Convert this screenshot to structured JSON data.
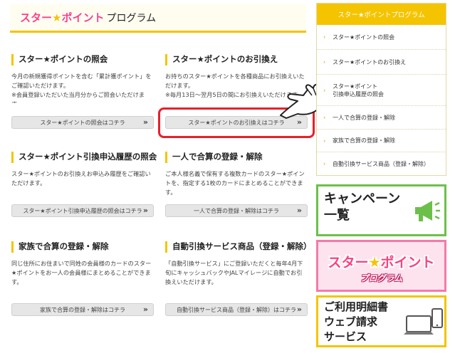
{
  "header": {
    "logo_text_1": "スター",
    "logo_star": "★",
    "logo_text_2": "ポイント",
    "subtitle": "プログラム"
  },
  "sections": [
    {
      "title": "スター★ポイントの照会",
      "desc": "今月の新規獲得ポイントを含む「累計獲ポイント」をご確認いただけます。\n※会員登録いただいた当月分からご照会いただけます。",
      "button": "スター★ポイントの照会はコチラ"
    },
    {
      "title": "スター★ポイントのお引換え",
      "desc": "お持ちのスター★ポイントを各種商品にお引換えいただけます。\n※毎月13日～翌月5日の間にお引換えいただけます。",
      "button": "スター★ポイントのお引換えはコチラ"
    },
    {
      "title": "スター★ポイント引換申込履歴の照会",
      "desc": "スター★ポイントのお引換えお申込み履歴をご確認いただけます。",
      "button": "スター★ポイント引換申込履歴の照会はコチラ"
    },
    {
      "title": "一人で合算の登録・解除",
      "desc": "ご本人様名義で保有する複数カードのスター★ポイントを、指定する1枚のカードにまとめることができます。",
      "button": "一人で合算の登録・解除はコチラ"
    },
    {
      "title": "家族で合算の登録・解除",
      "desc": "同じ住所にお住まいで同姓の会員様のカードのスター★ポイントをお一人の会員様にまとめることができます。",
      "button": "家族で合算の登録・解除はコチラ"
    },
    {
      "title": "自動引換サービス商品（登録・解除）",
      "desc": "「自動引換サービス」にご登録いただくと毎年4月下旬にキャッシュバックやJALマイレージに自動でお引換えいただけます。",
      "button": "自動引換サービス商品（登録・解除）はコチラ"
    }
  ],
  "chevron": "»",
  "sidebar": {
    "title": "スター★ポイントプログラム",
    "items": [
      "スター★ポイントの照会",
      "スター★ポイントのお引換え",
      "スター★ポイント\n引換申込履歴の照会",
      "一人で合算の登録・解除",
      "家族で合算の登録・解除",
      "自動引換サービス商品（登録・解除）"
    ],
    "arrow": "›"
  },
  "banners": {
    "campaign": "キャンペーン\n一覧",
    "star_logo_1": "スター",
    "star_logo_star": "★",
    "star_logo_2": "ポイント",
    "star_sub": "プログラム",
    "statement": "ご利用明細書\nウェブ請求\nサービス"
  },
  "colors": {
    "accent_yellow": "#f5c400",
    "brand_pink": "#ff3f7f",
    "highlight_red": "#e8202a",
    "campaign_green": "#6cc04a"
  }
}
